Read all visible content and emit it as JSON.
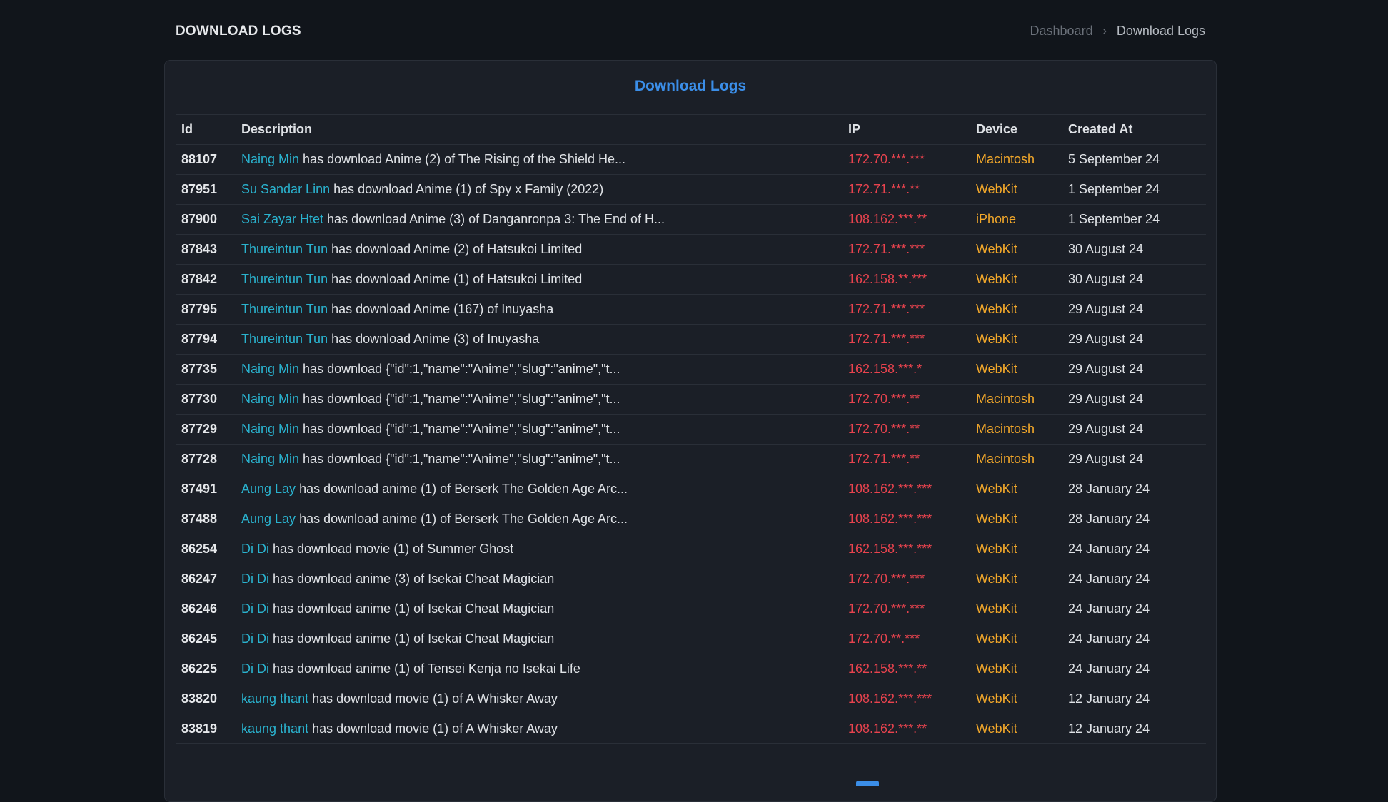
{
  "header": {
    "title": "DOWNLOAD LOGS",
    "breadcrumb": {
      "home": "Dashboard",
      "separator": "›",
      "current": "Download Logs"
    }
  },
  "card": {
    "title": "Download Logs",
    "columns": [
      "Id",
      "Description",
      "IP",
      "Device",
      "Created At"
    ]
  },
  "rows": [
    {
      "id": "88107",
      "user": "Naing Min",
      "text": " has download Anime (2) of The Rising of the Shield He...",
      "ip": "172.70.***.***",
      "device": "Macintosh",
      "date": "5 September 24"
    },
    {
      "id": "87951",
      "user": "Su Sandar Linn",
      "text": " has download Anime (1) of Spy x Family (2022)",
      "ip": "172.71.***.**",
      "device": "WebKit",
      "date": "1 September 24"
    },
    {
      "id": "87900",
      "user": "Sai Zayar Htet",
      "text": " has download Anime (3) of Danganronpa 3: The End of H...",
      "ip": "108.162.***.**",
      "device": "iPhone",
      "date": "1 September 24"
    },
    {
      "id": "87843",
      "user": "Thureintun Tun",
      "text": " has download Anime (2) of Hatsukoi Limited",
      "ip": "172.71.***.***",
      "device": "WebKit",
      "date": "30 August 24"
    },
    {
      "id": "87842",
      "user": "Thureintun Tun",
      "text": " has download Anime (1) of Hatsukoi Limited",
      "ip": "162.158.**.***",
      "device": "WebKit",
      "date": "30 August 24"
    },
    {
      "id": "87795",
      "user": "Thureintun Tun",
      "text": " has download Anime (167) of Inuyasha",
      "ip": "172.71.***.***",
      "device": "WebKit",
      "date": "29 August 24"
    },
    {
      "id": "87794",
      "user": "Thureintun Tun",
      "text": " has download Anime (3) of Inuyasha",
      "ip": "172.71.***.***",
      "device": "WebKit",
      "date": "29 August 24"
    },
    {
      "id": "87735",
      "user": "Naing Min",
      "text": " has download {\"id\":1,\"name\":\"Anime\",\"slug\":\"anime\",\"t...",
      "ip": "162.158.***.*",
      "device": "WebKit",
      "date": "29 August 24"
    },
    {
      "id": "87730",
      "user": "Naing Min",
      "text": " has download {\"id\":1,\"name\":\"Anime\",\"slug\":\"anime\",\"t...",
      "ip": "172.70.***.**",
      "device": "Macintosh",
      "date": "29 August 24"
    },
    {
      "id": "87729",
      "user": "Naing Min",
      "text": " has download {\"id\":1,\"name\":\"Anime\",\"slug\":\"anime\",\"t...",
      "ip": "172.70.***.**",
      "device": "Macintosh",
      "date": "29 August 24"
    },
    {
      "id": "87728",
      "user": "Naing Min",
      "text": " has download {\"id\":1,\"name\":\"Anime\",\"slug\":\"anime\",\"t...",
      "ip": "172.71.***.**",
      "device": "Macintosh",
      "date": "29 August 24"
    },
    {
      "id": "87491",
      "user": "Aung Lay",
      "text": " has download anime (1) of Berserk The Golden Age Arc...",
      "ip": "108.162.***.***",
      "device": "WebKit",
      "date": "28 January 24"
    },
    {
      "id": "87488",
      "user": "Aung Lay",
      "text": " has download anime (1) of Berserk The Golden Age Arc...",
      "ip": "108.162.***.***",
      "device": "WebKit",
      "date": "28 January 24"
    },
    {
      "id": "86254",
      "user": "Di Di",
      "text": " has download movie (1) of Summer Ghost",
      "ip": "162.158.***.***",
      "device": "WebKit",
      "date": "24 January 24"
    },
    {
      "id": "86247",
      "user": "Di Di",
      "text": " has download anime (3) of Isekai Cheat Magician",
      "ip": "172.70.***.***",
      "device": "WebKit",
      "date": "24 January 24"
    },
    {
      "id": "86246",
      "user": "Di Di",
      "text": " has download anime (1) of Isekai Cheat Magician",
      "ip": "172.70.***.***",
      "device": "WebKit",
      "date": "24 January 24"
    },
    {
      "id": "86245",
      "user": "Di Di",
      "text": " has download anime (1) of Isekai Cheat Magician",
      "ip": "172.70.**.***",
      "device": "WebKit",
      "date": "24 January 24"
    },
    {
      "id": "86225",
      "user": "Di Di",
      "text": " has download anime (1) of Tensei Kenja no Isekai Life",
      "ip": "162.158.***.**",
      "device": "WebKit",
      "date": "24 January 24"
    },
    {
      "id": "83820",
      "user": "kaung thant",
      "text": " has download movie (1) of A Whisker Away",
      "ip": "108.162.***.***",
      "device": "WebKit",
      "date": "12 January 24"
    },
    {
      "id": "83819",
      "user": "kaung thant",
      "text": " has download movie (1) of A Whisker Away",
      "ip": "108.162.***.**",
      "device": "WebKit",
      "date": "12 January 24"
    }
  ]
}
